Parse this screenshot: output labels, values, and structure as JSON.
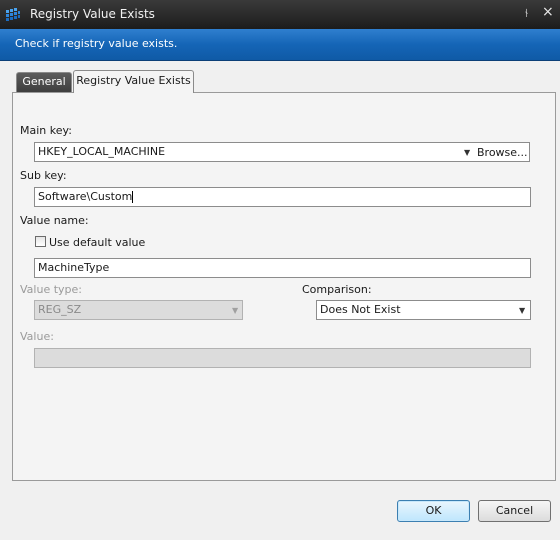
{
  "window": {
    "title": "Registry Value Exists",
    "pin_glyph": "⫮",
    "close_glyph": "×"
  },
  "banner": {
    "text": "Check if registry value exists."
  },
  "tabs": [
    {
      "label": "General",
      "selected": false
    },
    {
      "label": "Registry Value Exists",
      "selected": true
    }
  ],
  "form": {
    "main_key_label": "Main key:",
    "main_key_value": "HKEY_LOCAL_MACHINE",
    "browse_label": "Browse...",
    "sub_key_label": "Sub key:",
    "sub_key_value": "Software\\Custom",
    "value_name_label": "Value name:",
    "use_default_label": "Use default value",
    "use_default_checked": false,
    "value_name_value": "MachineType",
    "value_type_label": "Value type:",
    "value_type_value": "REG_SZ",
    "comparison_label": "Comparison:",
    "comparison_value": "Does Not Exist",
    "value_label": "Value:",
    "value_value": ""
  },
  "buttons": {
    "ok": "OK",
    "cancel": "Cancel"
  },
  "colors": {
    "title_bar": "#1c1c1c",
    "banner": "#1565b6",
    "panel": "#f4f4f4",
    "default_button": "#bee6fd"
  },
  "icons": {
    "app": "grid-app-icon",
    "pin": "pin-icon",
    "close": "close-icon",
    "dropdown": "chevron-down-icon"
  }
}
